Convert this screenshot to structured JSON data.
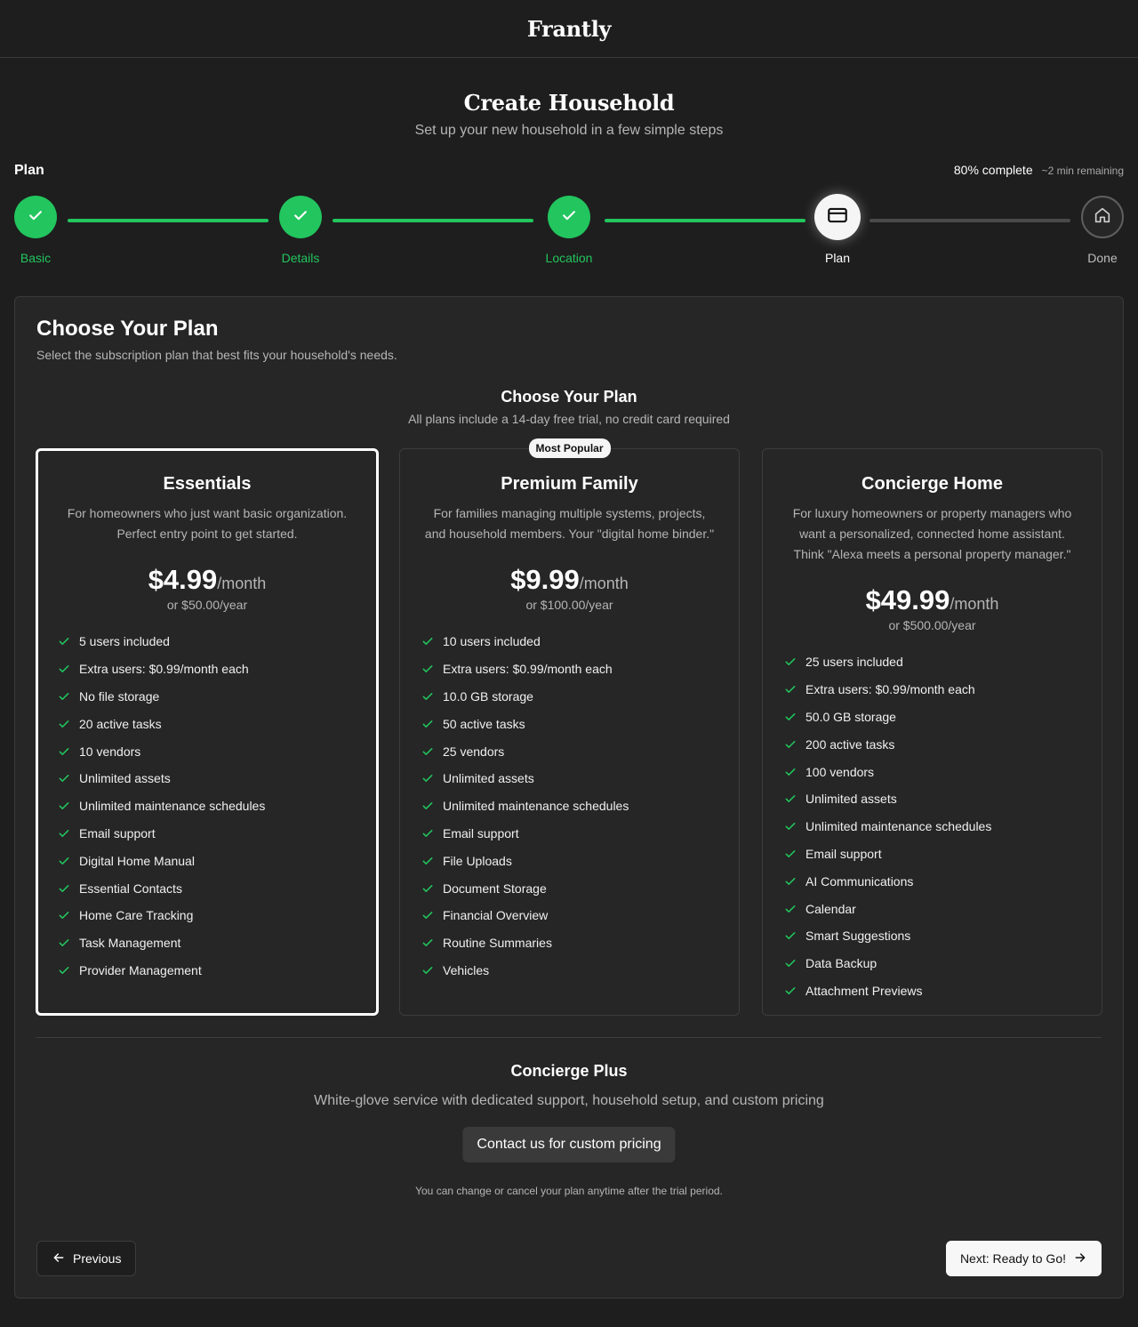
{
  "brand": "Frantly",
  "header": {
    "title": "Create Household",
    "subtitle": "Set up your new household in a few simple steps"
  },
  "progress": {
    "current_step": "Plan",
    "percent_label": "80% complete",
    "remaining": "~2 min remaining",
    "fraction": 0.8
  },
  "steps": [
    {
      "label": "Basic",
      "status": "done",
      "icon": "check-icon"
    },
    {
      "label": "Details",
      "status": "done",
      "icon": "check-icon"
    },
    {
      "label": "Location",
      "status": "done",
      "icon": "check-icon"
    },
    {
      "label": "Plan",
      "status": "current",
      "icon": "credit-card-icon"
    },
    {
      "label": "Done",
      "status": "todo",
      "icon": "home-icon"
    }
  ],
  "panel": {
    "title": "Choose Your Plan",
    "subtitle": "Select the subscription plan that best fits your household's needs.",
    "section_title": "Choose Your Plan",
    "section_subtitle": "All plans include a 14-day free trial, no credit card required"
  },
  "plans": [
    {
      "name": "Essentials",
      "description": "For homeowners who just want basic organization. Perfect entry point to get started.",
      "price": "$4.99",
      "period": "/month",
      "yearly": "or $50.00/year",
      "selected": true,
      "features": [
        "5 users included",
        "Extra users: $0.99/month each",
        "No file storage",
        "20 active tasks",
        "10 vendors",
        "Unlimited assets",
        "Unlimited maintenance schedules",
        "Email support",
        "Digital Home Manual",
        "Essential Contacts",
        "Home Care Tracking",
        "Task Management",
        "Provider Management"
      ]
    },
    {
      "name": "Premium Family",
      "badge": "Most Popular",
      "description": "For families managing multiple systems, projects, and household members. Your \"digital home binder.\"",
      "price": "$9.99",
      "period": "/month",
      "yearly": "or $100.00/year",
      "selected": false,
      "features": [
        "10 users included",
        "Extra users: $0.99/month each",
        "10.0 GB storage",
        "50 active tasks",
        "25 vendors",
        "Unlimited assets",
        "Unlimited maintenance schedules",
        "Email support",
        "File Uploads",
        "Document Storage",
        "Financial Overview",
        "Routine Summaries",
        "Vehicles"
      ]
    },
    {
      "name": "Concierge Home",
      "description": "For luxury homeowners or property managers who want a personalized, connected home assistant. Think \"Alexa meets a personal property manager.\"",
      "price": "$49.99",
      "period": "/month",
      "yearly": "or $500.00/year",
      "selected": false,
      "features": [
        "25 users included",
        "Extra users: $0.99/month each",
        "50.0 GB storage",
        "200 active tasks",
        "100 vendors",
        "Unlimited assets",
        "Unlimited maintenance schedules",
        "Email support",
        "AI Communications",
        "Calendar",
        "Smart Suggestions",
        "Data Backup",
        "Attachment Previews"
      ]
    }
  ],
  "concierge_plus": {
    "title": "Concierge Plus",
    "subtitle": "White-glove service with dedicated support, household setup, and custom pricing",
    "button": "Contact us for custom pricing"
  },
  "fine_print": "You can change or cancel your plan anytime after the trial period.",
  "nav": {
    "previous": "Previous",
    "next": "Next: Ready to Go!"
  },
  "colors": {
    "accent_green": "#22c55e",
    "background": "#1e1e1e",
    "panel": "#262626"
  }
}
